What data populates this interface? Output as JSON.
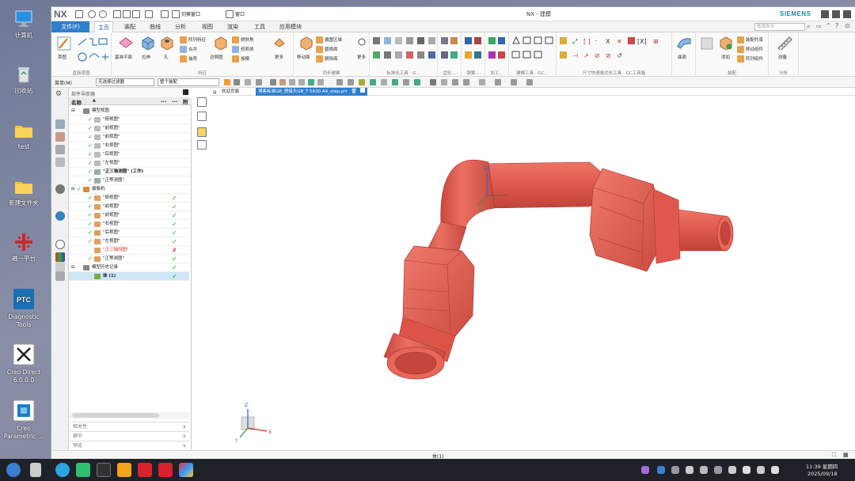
{
  "desktop": {
    "icons": [
      {
        "label": "计算机",
        "icon": "computer-icon"
      },
      {
        "label": "回收站",
        "icon": "recycle-bin-icon"
      },
      {
        "label": "test",
        "icon": "folder-icon"
      },
      {
        "label": "新建文件夹",
        "icon": "folder-icon"
      },
      {
        "label": "融一平台",
        "icon": "platform-icon"
      },
      {
        "label": "Diagnostic Tools",
        "icon": "ptc-icon"
      },
      {
        "label": "Creo Direct 6.0.0.0",
        "icon": "creo-direct-icon"
      },
      {
        "label": "Creo Parametric ...",
        "icon": "creo-parametric-icon"
      }
    ]
  },
  "app": {
    "logo": "NX",
    "title": "NX - 建模",
    "brand": "SIEMENS",
    "quick_access": {
      "switch_window": "切换窗口",
      "window": "窗口"
    },
    "search_placeholder": "查找命令"
  },
  "menu_tabs": [
    {
      "label": "文件(F)",
      "state": "file"
    },
    {
      "label": "主页",
      "state": "active"
    },
    {
      "label": "装配",
      "state": ""
    },
    {
      "label": "曲线",
      "state": ""
    },
    {
      "label": "分析",
      "state": ""
    },
    {
      "label": "视图",
      "state": ""
    },
    {
      "label": "渲染",
      "state": ""
    },
    {
      "label": "工具",
      "state": ""
    },
    {
      "label": "应用模块",
      "state": ""
    }
  ],
  "ribbon": {
    "groups": [
      "直接草图",
      "特征",
      "同步建模",
      "标准化工具 - G...",
      "齿轮...",
      "弹簧...",
      "加工...",
      "建模工具 - GC...",
      "尺寸快速格式化工具 - GC工具箱",
      "装配",
      "分析"
    ],
    "sketch": {
      "sketch_label": "草图"
    },
    "feature": {
      "datum_plane": "基准平面",
      "extrude": "拉伸",
      "hole": "孔",
      "pattern_feature": "阵列特征",
      "unite": "合并",
      "shell": "抽壳",
      "edge_blend": "边倒圆",
      "chamfer": "倒斜角",
      "trim_body": "修剪体",
      "draft": "拔模",
      "more": "更多"
    },
    "sync": {
      "move_face": "移动面",
      "offset_region": "偏置区域",
      "replace_face": "替换面",
      "delete_face": "删除面",
      "more": "更多"
    },
    "surface": {
      "label": "曲面"
    },
    "assembly": {
      "assembly_constraints": "装配约束",
      "move_component": "移动组件",
      "pattern_component": "阵列组件",
      "add": "添加",
      "new_component": "新建组件"
    },
    "analysis": {
      "measure": "测量"
    }
  },
  "selection_bar": {
    "menu_label": "菜单(M)",
    "type_filter": "无选择过滤器",
    "scope": "整个装配"
  },
  "navigator": {
    "title": "部件导航器",
    "columns": {
      "name": "名称",
      "c1": "...",
      "c2": "...",
      "c3": "附"
    },
    "rows": [
      {
        "label": "模型视图",
        "indent": 0,
        "kind": "folder",
        "check": "",
        "state": "",
        "bold": false
      },
      {
        "label": "\"俯视图\"",
        "indent": 1,
        "kind": "view",
        "check": "✓",
        "state": "",
        "bold": false
      },
      {
        "label": "\"前视图\"",
        "indent": 1,
        "kind": "view",
        "check": "✓",
        "state": "",
        "bold": false
      },
      {
        "label": "\"前视图\"",
        "indent": 1,
        "kind": "view",
        "check": "✓",
        "state": "",
        "bold": false
      },
      {
        "label": "\"右视图\"",
        "indent": 1,
        "kind": "view",
        "check": "✓",
        "state": "",
        "bold": false
      },
      {
        "label": "\"后视图\"",
        "indent": 1,
        "kind": "view",
        "check": "✓",
        "state": "",
        "bold": false
      },
      {
        "label": "\"左视图\"",
        "indent": 1,
        "kind": "view",
        "check": "✓",
        "state": "",
        "bold": false
      },
      {
        "label": "\"正三轴测图\" (工作)",
        "indent": 1,
        "kind": "iso",
        "check": "✓",
        "state": "",
        "bold": true
      },
      {
        "label": "\"正等测图\"",
        "indent": 1,
        "kind": "iso",
        "check": "✓",
        "state": "",
        "bold": false
      },
      {
        "label": "摄像机",
        "indent": 0,
        "kind": "camera-folder",
        "check": "✓",
        "state": "",
        "bold": false
      },
      {
        "label": "\"俯视图\"",
        "indent": 1,
        "kind": "camera",
        "check": "✓",
        "state": "✓",
        "bold": false
      },
      {
        "label": "\"前视图\"",
        "indent": 1,
        "kind": "camera",
        "check": "✓",
        "state": "✓",
        "bold": false
      },
      {
        "label": "\"前视图\"",
        "indent": 1,
        "kind": "camera",
        "check": "✓",
        "state": "✓",
        "bold": false
      },
      {
        "label": "\"右视图\"",
        "indent": 1,
        "kind": "camera",
        "check": "✓",
        "state": "✓",
        "bold": false
      },
      {
        "label": "\"后视图\"",
        "indent": 1,
        "kind": "camera",
        "check": "✓",
        "state": "✓",
        "bold": false
      },
      {
        "label": "\"左视图\"",
        "indent": 1,
        "kind": "camera",
        "check": "✓",
        "state": "✓",
        "bold": false
      },
      {
        "label": "\"正三轴测图\"",
        "indent": 1,
        "kind": "camera-red",
        "check": "",
        "state": "✗",
        "bold": false
      },
      {
        "label": "\"正等测图\"",
        "indent": 1,
        "kind": "camera",
        "check": "✓",
        "state": "✓",
        "bold": false
      },
      {
        "label": "模型历史记录",
        "indent": 0,
        "kind": "folder",
        "check": "",
        "state": "✓",
        "bold": false
      },
      {
        "label": "体 (1)",
        "indent": 1,
        "kind": "body",
        "check": "",
        "state": "✓",
        "bold": true
      }
    ],
    "accordion": [
      "相关性",
      "细节",
      "预览"
    ]
  },
  "doc_tabs": [
    {
      "label": "欢迎页面",
      "active": false
    },
    {
      "label": "博客标准GB_焊接头GB_T 5630 A4_step.prt",
      "active": true
    }
  ],
  "viewport": {
    "triad_labels": {
      "x": "X",
      "y": "Y",
      "z": "Z"
    },
    "wcs_labels": {
      "xc": "XC",
      "yc": "YC",
      "zc": "ZC"
    }
  },
  "status": {
    "selection": "体(1)"
  },
  "taskbar": {
    "time": "11:39 星期四",
    "date": "2025/09/18"
  },
  "colors": {
    "model_fill": "#e0584d",
    "model_shadow": "#b53a33",
    "model_highlight": "#f2877c",
    "accent_blue": "#2f7fd0",
    "siemens_teal": "#0a8f9c",
    "check_green": "#2a9a2a",
    "error_red": "#e0302a"
  }
}
